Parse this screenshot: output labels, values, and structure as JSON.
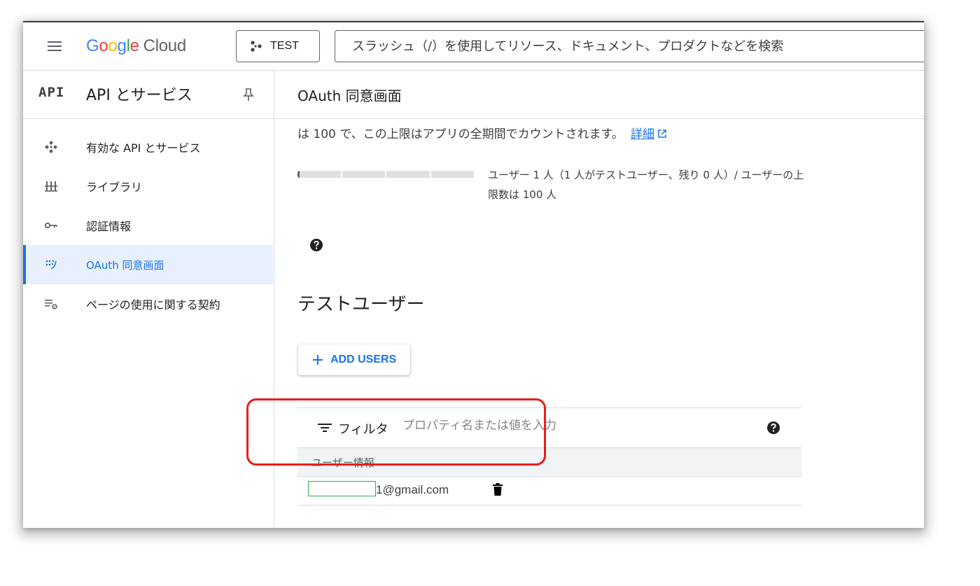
{
  "topbar": {
    "menu_icon": "hamburger-menu-icon",
    "logo": {
      "letters": [
        "G",
        "o",
        "o",
        "g",
        "l",
        "e"
      ],
      "product": "Cloud"
    },
    "project": {
      "icon": "project-dots-icon",
      "label": "TEST"
    },
    "search": {
      "placeholder": "スラッシュ（/）を使用してリソース、ドキュメント、プロダクトなどを検索",
      "value": ""
    }
  },
  "sidebar": {
    "badge": "API",
    "title": "API とサービス",
    "pin_icon": "pin-icon",
    "items": [
      {
        "label": "有効な API とサービス",
        "icon": "api-diamond-icon",
        "active": false
      },
      {
        "label": "ライブラリ",
        "icon": "library-icon",
        "active": false
      },
      {
        "label": "認証情報",
        "icon": "key-icon",
        "active": false
      },
      {
        "label": "OAuth 同意画面",
        "icon": "consent-screen-icon",
        "active": true
      },
      {
        "label": "ページの使用に関する契約",
        "icon": "page-agreements-icon",
        "active": false
      }
    ]
  },
  "main": {
    "title": "OAuth 同意画面",
    "limit_text": "は 100 で、この上限はアプリの全期間でカウントされます。",
    "details_link": "詳細",
    "usage": {
      "text": "ユーザー 1 人（1 人がテストユーザー、残り 0 人）/ ユーザーの上限数は 100 人",
      "used": 1,
      "limit": 100
    },
    "test_users": {
      "section_title": "テストユーザー",
      "add_button": "ADD USERS",
      "filter_label": "フィルタ",
      "filter_placeholder": "プロパティ名または値を入力",
      "column_header": "ユーザー情報",
      "rows": [
        {
          "email": "1@gmail.com"
        }
      ]
    }
  },
  "colors": {
    "accent": "#1a73e8",
    "active_bg": "#e8f0fe",
    "highlight": "#ea1c1c",
    "mask_border": "#34a853"
  }
}
